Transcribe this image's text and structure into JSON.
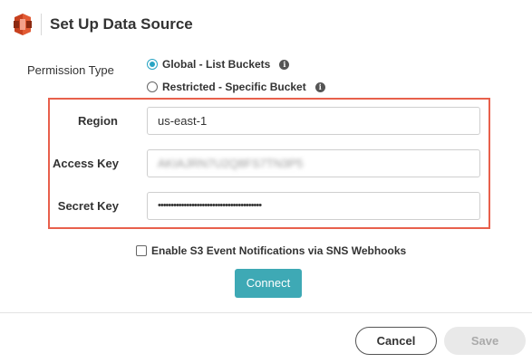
{
  "header": {
    "title": "Set Up Data Source",
    "logo_icon": "aws-s3-icon"
  },
  "permission": {
    "label": "Permission Type",
    "options": [
      {
        "label": "Global - List Buckets",
        "checked": true
      },
      {
        "label": "Restricted - Specific Bucket",
        "checked": false
      }
    ]
  },
  "fields": {
    "region": {
      "label": "Region",
      "value": "us-east-1"
    },
    "access_key": {
      "label": "Access Key",
      "value": "AKIAJRN7U2Q8FS7TN3P5"
    },
    "secret_key": {
      "label": "Secret Key",
      "value": "••••••••••••••••••••••••••••••••••••••••"
    }
  },
  "sns_checkbox": {
    "label": "Enable S3 Event Notifications via SNS Webhooks",
    "checked": false
  },
  "buttons": {
    "connect": "Connect",
    "cancel": "Cancel",
    "save": "Save"
  },
  "colors": {
    "accent": "#27a4c3",
    "connect_button": "#3ea9b5",
    "highlight_border": "#e8604c",
    "logo": "#c7411f"
  }
}
